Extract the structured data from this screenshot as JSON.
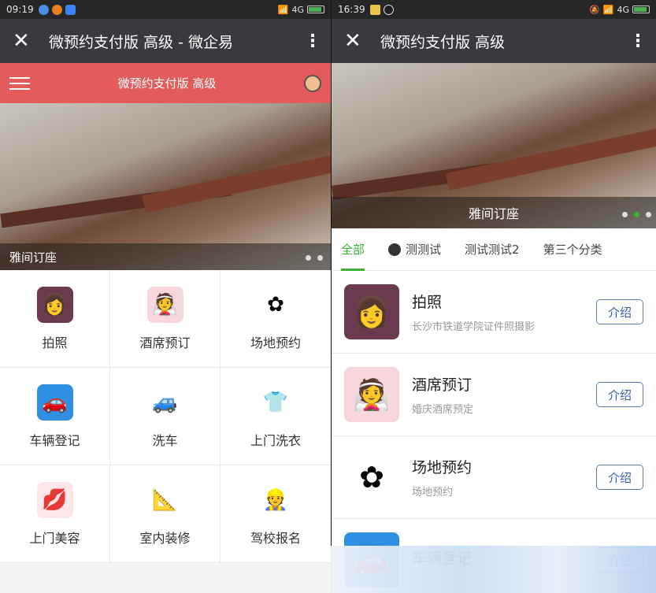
{
  "left": {
    "status": {
      "time": "09:19",
      "network": "4G"
    },
    "titlebar": {
      "title": "微预约支付版 高级 - 微企易"
    },
    "header": {
      "title": "微预约支付版 高级"
    },
    "banner": {
      "caption": "雅间订座"
    },
    "grid": [
      {
        "label": "拍照",
        "icon": "portrait-icon",
        "glyph": "👩",
        "bg": "#6b3a4e"
      },
      {
        "label": "酒席预订",
        "icon": "wedding-icon",
        "glyph": "👰",
        "bg": "#f7d6dc"
      },
      {
        "label": "场地预约",
        "icon": "flower-icon",
        "glyph": "✿",
        "bg": "#ffffff"
      },
      {
        "label": "车辆登记",
        "icon": "car-icon",
        "glyph": "🚗",
        "bg": "#2f8fe0"
      },
      {
        "label": "洗车",
        "icon": "carwash-icon",
        "glyph": "🚙",
        "bg": "#ffffff"
      },
      {
        "label": "上门洗衣",
        "icon": "clothes-icon",
        "glyph": "👕",
        "bg": "#ffffff"
      },
      {
        "label": "上门美容",
        "icon": "lips-icon",
        "glyph": "💋",
        "bg": "#fde6ea"
      },
      {
        "label": "室内装修",
        "icon": "tools-icon",
        "glyph": "📐",
        "bg": "#ffffff"
      },
      {
        "label": "驾校报名",
        "icon": "driver-icon",
        "glyph": "👷",
        "bg": "#ffffff"
      }
    ]
  },
  "right": {
    "status": {
      "time": "16:39",
      "network": "4G"
    },
    "titlebar": {
      "title": "微预约支付版 高级"
    },
    "banner": {
      "caption": "雅间订座"
    },
    "tabs": [
      {
        "label": "全部"
      },
      {
        "label": "测测试"
      },
      {
        "label": "测试测试2"
      },
      {
        "label": "第三个分类"
      }
    ],
    "intro_label": "介绍",
    "items": [
      {
        "name": "拍照",
        "desc": "长沙市铁道学院证件照摄影",
        "glyph": "👩",
        "bg": "#6b3a4e"
      },
      {
        "name": "酒席预订",
        "desc": "婚庆酒席预定",
        "glyph": "👰",
        "bg": "#f7d6dc"
      },
      {
        "name": "场地预约",
        "desc": "场地预约",
        "glyph": "✿",
        "bg": "#ffffff"
      },
      {
        "name": "车辆登记",
        "desc": "",
        "glyph": "🚗",
        "bg": "#2f8fe0"
      }
    ]
  }
}
